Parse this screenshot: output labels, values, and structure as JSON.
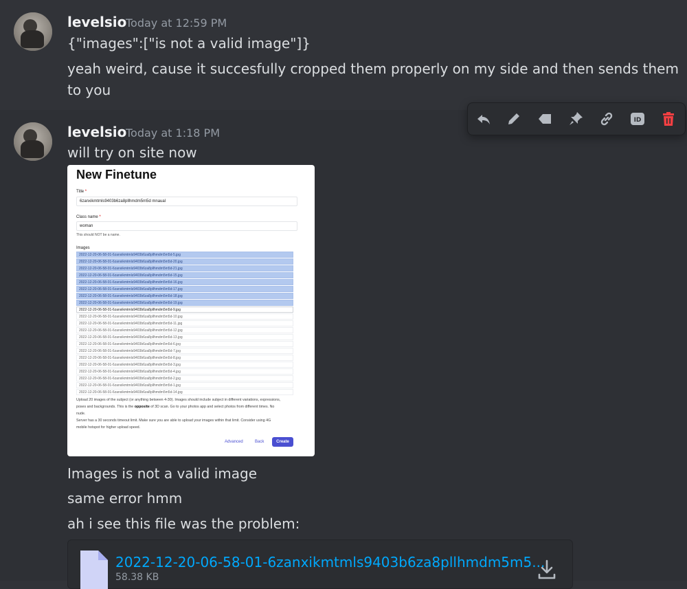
{
  "messages": [
    {
      "username": "levelsio",
      "timestamp": "Today at 12:59 PM",
      "lines": [
        "{\"images\":[\"is not a valid image\"]}",
        "yeah weird, cause it succesfully cropped them properly on my side and then sends them",
        "to you"
      ]
    },
    {
      "username": "levelsio",
      "timestamp": "Today at 1:18 PM",
      "lines": [
        "will try on site now",
        "Images is not a valid image",
        "same error hmm",
        "ah i see this file was the problem:"
      ]
    }
  ],
  "toolbar": {
    "icons": [
      "reply-icon",
      "edit-icon",
      "tag-icon",
      "pin-icon",
      "link-icon",
      "copy-id-icon",
      "delete-icon"
    ],
    "id_label": "ID",
    "delete_color": "#f23f42"
  },
  "screenshot": {
    "title": "New Finetune",
    "title_label": "Title",
    "title_value": "6zanxikmtmls9403b6za8pllhmdm5m5d mnaual",
    "class_label": "Class name",
    "class_value": "woman",
    "class_help": "This should NOT be a name.",
    "images_label": "Images",
    "files": [
      "2022-12-20-06-58-01-6zanxikmtmls9403b6za8pllhmdm5m5d-5.jpg",
      "2022-12-20-06-58-01-6zanxikmtmls9403b6za8pllhmdm5m5d-20.jpg",
      "2022-12-20-06-58-01-6zanxikmtmls9403b6za8pllhmdm5m5d-21.jpg",
      "2022-12-20-06-58-01-6zanxikmtmls9403b6za8pllhmdm5m5d-15.jpg",
      "2022-12-20-06-58-01-6zanxikmtmls9403b6za8pllhmdm5m5d-16.jpg",
      "2022-12-20-06-58-01-6zanxikmtmls9403b6za8pllhmdm5m5d-17.jpg",
      "2022-12-20-06-58-01-6zanxikmtmls9403b6za8pllhmdm5m5d-18.jpg",
      "2022-12-20-06-58-01-6zanxikmtmls9403b6za8pllhmdm5m5d-19.jpg",
      "2022-12-20-06-58-01-6zanxikmtmls9403b6za8pllhmdm5m5d-9.jpg",
      "2022-12-20-06-58-01-6zanxikmtmls9403b6za8pllhmdm5m5d-10.jpg",
      "2022-12-20-06-58-01-6zanxikmtmls9403b6za8pllhmdm5m5d-11.jpg",
      "2022-12-20-06-58-01-6zanxikmtmls9403b6za8pllhmdm5m5d-12.jpg",
      "2022-12-20-06-58-01-6zanxikmtmls9403b6za8pllhmdm5m5d-13.jpg",
      "2022-12-20-06-58-01-6zanxikmtmls9403b6za8pllhmdm5m5d-6.jpg",
      "2022-12-20-06-58-01-6zanxikmtmls9403b6za8pllhmdm5m5d-7.jpg",
      "2022-12-20-06-58-01-6zanxikmtmls9403b6za8pllhmdm5m5d-8.jpg",
      "2022-12-20-06-58-01-6zanxikmtmls9403b6za8pllhmdm5m5d-3.jpg",
      "2022-12-20-06-58-01-6zanxikmtmls9403b6za8pllhmdm5m5d-4.jpg",
      "2022-12-20-06-58-01-6zanxikmtmls9403b6za8pllhmdm5m5d-2.jpg",
      "2022-12-20-06-58-01-6zanxikmtmls9403b6za8pllhmdm5m5d-1.jpg",
      "2022-12-20-06-58-01-6zanxikmtmls9403b6za8pllhmdm5m5d-14.jpg"
    ],
    "selected_count": 8,
    "current_index": 8,
    "desc_line1a": "Upload 20 images of the subject (or anything between 4-30). Images should include subject in different variations, expressions,",
    "desc_line2a": "poses and backgrounds. This is the ",
    "desc_bold": "opposite",
    "desc_line2b": " of 3D scan. Go to your photos app and select photos from different times. No",
    "desc_line3": "nude.",
    "desc_line4": "Server has a 30 seconds timeout limit. Make sure you are able to upload your images within that limit. Consider using 4G",
    "desc_line5": "mobile hotspot for higher upload speed.",
    "btn_advanced": "Advanced",
    "btn_back": "Back",
    "btn_create": "Create"
  },
  "file": {
    "name": "2022-12-20-06-58-01-6zanxikmtmls9403b6za8pllhmdm5m5...",
    "size": "58.38 KB"
  }
}
